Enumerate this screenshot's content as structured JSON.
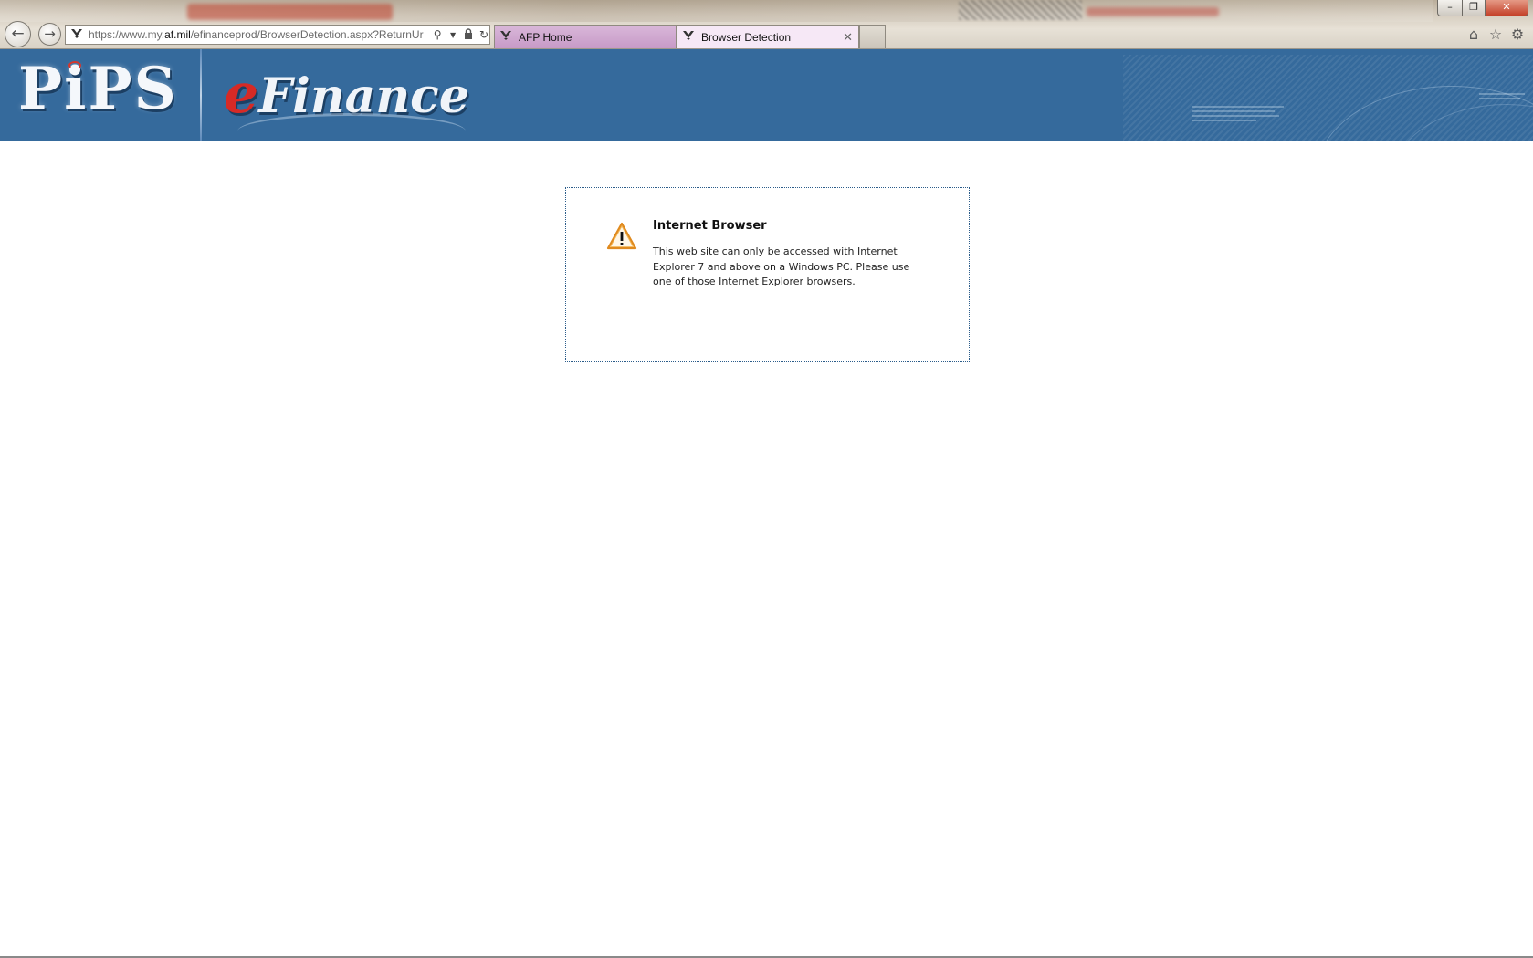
{
  "window": {
    "controls": {
      "minimize": "–",
      "maximize": "❐",
      "close": "✕"
    }
  },
  "navigation": {
    "back_icon": "arrow-left-icon",
    "forward_icon": "arrow-right-icon"
  },
  "address_bar": {
    "url_prefix": "https://www.my.",
    "url_domain": "af.mil",
    "url_path": "/efinanceprod/BrowserDetection.aspx?ReturnUr",
    "favicon": "af-wings-icon"
  },
  "tabs": [
    {
      "label": "AFP Home",
      "active": false,
      "color": "#c79ac7"
    },
    {
      "label": "Browser Detection",
      "active": true,
      "color": "#f6e8f6"
    }
  ],
  "toolbar": {
    "home_icon": "home-icon",
    "favorites_icon": "star-icon",
    "tools_icon": "gear-icon"
  },
  "banner": {
    "logo_left": "PiPS",
    "logo_right_e": "e",
    "logo_right_rest": "Finance",
    "background": "#356a9c"
  },
  "alert": {
    "icon": "warning-icon",
    "title": "Internet Browser",
    "message": "This web site can only be accessed with Internet Explorer 7 and above on a Windows PC. Please use one of those Internet Explorer browsers."
  }
}
